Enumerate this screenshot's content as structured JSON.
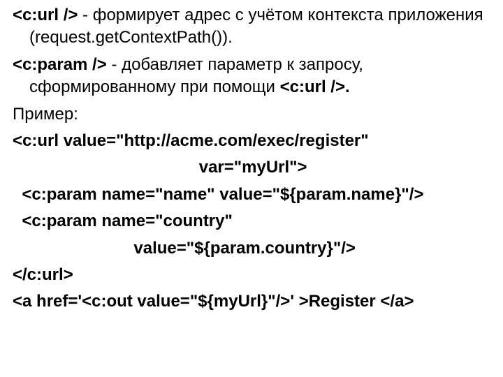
{
  "p1": {
    "tag_open": "<c:url />",
    "rest": " - формирует адрес с учётом контекста приложения (request.getContextPath())."
  },
  "p2": {
    "tag_open": "<c:param />",
    "mid": " - добавляет параметр к запросу, сформированному при помощи ",
    "tag_ref": "<c:url />.",
    "tail": ""
  },
  "example_label": "Пример:",
  "code": {
    "l1": "<c:url value=\"http://acme.com/exec/register\"",
    "l2": "                                        var=\"myUrl\">",
    "l3": "  <c:param name=\"name\" value=\"${param.name}\"/>",
    "l4": "  <c:param name=\"country\"",
    "l5": "                          value=\"${param.country}\"/>",
    "l6": "</c:url>",
    "l7": "<a href='<c:out value=\"${myUrl}\"/>' >Register </a>"
  }
}
